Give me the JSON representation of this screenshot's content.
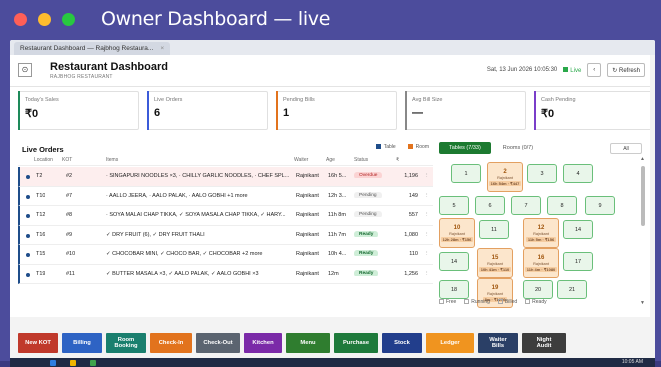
{
  "window": {
    "title": "Owner Dashboard — live"
  },
  "browser": {
    "tab_label": "Restaurant Dashboard — Rajbhog Restaura...",
    "tab_close": "×"
  },
  "header": {
    "title": "Restaurant Dashboard",
    "subtitle": "RAJBHOG RESTAURANT",
    "datetime": "Sat, 13 Jun 2026  10:05:30",
    "live_label": "Live",
    "refresh_label": "↻ Refresh",
    "home_icon": "⊙",
    "back_icon": "‹"
  },
  "kpis": [
    {
      "label": "Today's Sales",
      "value": "₹0",
      "accent": "#1e8a5a"
    },
    {
      "label": "Live Orders",
      "value": "6",
      "accent": "#3b5bd9"
    },
    {
      "label": "Pending Bills",
      "value": "1",
      "accent": "#e2731d"
    },
    {
      "label": "Avg Bill Size",
      "value": "—",
      "accent": "#888888"
    },
    {
      "label": "Cash Pending",
      "value": "₹0",
      "accent": "#7a3ec9"
    }
  ],
  "orders": {
    "title": "Live Orders",
    "legend": [
      {
        "label": "Table",
        "color": "#1f4d8a"
      },
      {
        "label": "Room",
        "color": "#e2731d"
      }
    ],
    "columns": [
      "Location",
      "KOT",
      "Items",
      "Waiter",
      "Age",
      "Status",
      "₹"
    ],
    "rows": [
      {
        "location": "T2",
        "kot": "#2",
        "items": "· SINGAPURI NOODLES ×3, · CHILLY GARLIC NOODLES, · CHEF SPL...",
        "waiter": "Rajnikant",
        "age": "16h 5...",
        "status": "Overdue",
        "amount": "1,196"
      },
      {
        "location": "T10",
        "kot": "#7",
        "items": "· AALLO JEERA, · AALO PALAK, · AALO GOBHI +1 more",
        "waiter": "Rajnikant",
        "age": "12h 3...",
        "status": "Pending",
        "amount": "149"
      },
      {
        "location": "T12",
        "kot": "#8",
        "items": "· SOYA MALAI CHAP TIKKA, ✓ SOYA MASALA CHAP TIKKA, ✓ HARY...",
        "waiter": "Rajnikant",
        "age": "11h 8m",
        "status": "Pending",
        "amount": "557"
      },
      {
        "location": "T16",
        "kot": "#9",
        "items": "✓ DRY FRUIT (6), ✓ DRY FRUIT THALI",
        "waiter": "Rajnikant",
        "age": "11h 7m",
        "status": "Ready",
        "amount": "1,080"
      },
      {
        "location": "T15",
        "kot": "#10",
        "items": "✓ CHOCOBAR MINI, ✓ CHOCO BAR, ✓ CHOCOBAR +2 more",
        "waiter": "Rajnikant",
        "age": "10h 4...",
        "status": "Ready",
        "amount": "110"
      },
      {
        "location": "T19",
        "kot": "#11",
        "items": "✓ BUTTER MASALA ×3, ✓ AALO PALAK, ✓ AALO GOBHI ×3",
        "waiter": "Rajnikant",
        "age": "12m",
        "status": "Ready",
        "amount": "1,256"
      }
    ]
  },
  "tables": {
    "tabs": [
      "Tables (7/33)",
      "Rooms (0/7)"
    ],
    "filter": "All",
    "tiles": [
      {
        "num": "1"
      },
      {
        "num": "2",
        "occ": true,
        "who": "Rajnikant",
        "amt": "16h 54m · ₹447"
      },
      {
        "num": "3"
      },
      {
        "num": "4"
      },
      {
        "num": "5"
      },
      {
        "num": "6"
      },
      {
        "num": "7"
      },
      {
        "num": "8"
      },
      {
        "num": "9"
      },
      {
        "num": "10",
        "occ": true,
        "who": "Rajnikant",
        "amt": "12h 28m · ₹156"
      },
      {
        "num": "11"
      },
      {
        "num": "12",
        "occ": true,
        "who": "Rajnikant",
        "amt": "11h 5m · ₹156"
      },
      {
        "num": "14"
      },
      {
        "num": "14"
      },
      {
        "num": "15",
        "occ": true,
        "who": "Rajnikant",
        "amt": "10h 41m · ₹110"
      },
      {
        "num": "16",
        "occ": true,
        "who": "Rajnikant",
        "amt": "11h 4m · ₹1080"
      },
      {
        "num": "17"
      },
      {
        "num": "18"
      },
      {
        "num": "19",
        "occ": true,
        "who": "Rajnikant",
        "amt": "8m · ₹1256"
      },
      {
        "num": "20"
      },
      {
        "num": "21"
      }
    ],
    "key": [
      "Free",
      "Running",
      "Billed",
      "Ready"
    ]
  },
  "actions": [
    {
      "label": "New KOT",
      "color": "#c0392b"
    },
    {
      "label": "Billing",
      "color": "#2e63c4"
    },
    {
      "label": "Room Booking",
      "color": "#1a7f6e"
    },
    {
      "label": "Check-In",
      "color": "#e2731d"
    },
    {
      "label": "Check-Out",
      "color": "#5b6470"
    },
    {
      "label": "Kitchen",
      "color": "#7b2aa8"
    },
    {
      "label": "Menu",
      "color": "#2f7d2f"
    },
    {
      "label": "Purchase",
      "color": "#1e7a3b"
    },
    {
      "label": "Stock",
      "color": "#223e8c"
    },
    {
      "label": "Ledger",
      "color": "#f0941f"
    },
    {
      "label": "Waiter Bills",
      "color": "#2a3f66"
    },
    {
      "label": "Night Audit",
      "color": "#3d3d3d"
    }
  ],
  "taskbar": {
    "clock": "10:05 AM"
  }
}
